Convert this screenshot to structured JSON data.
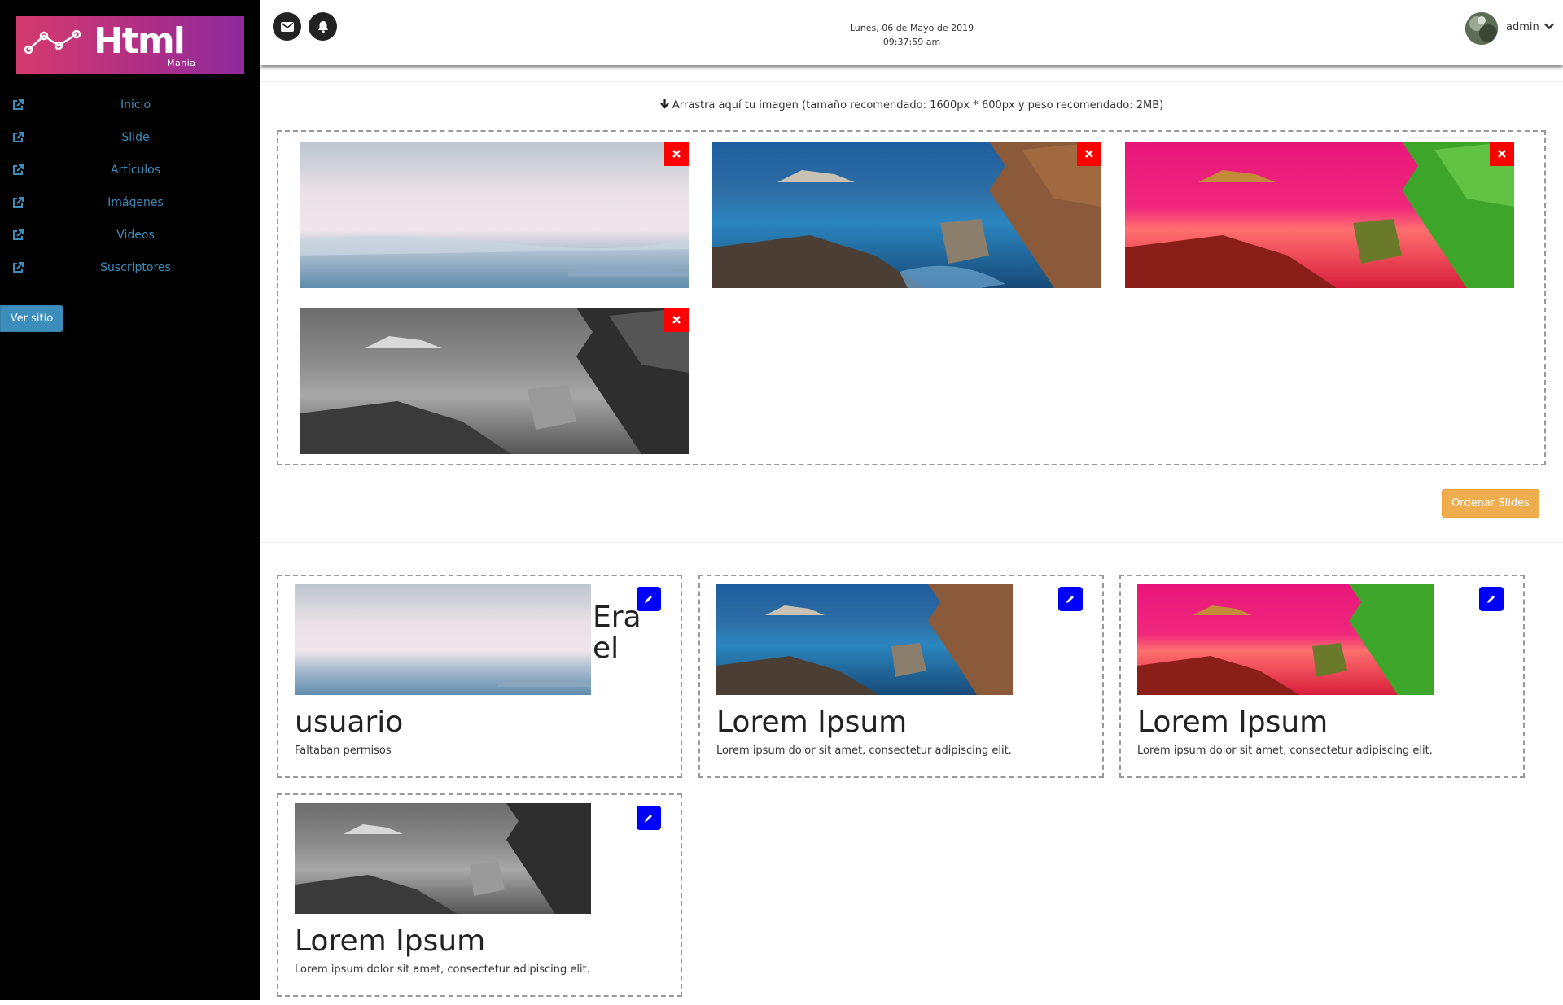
{
  "brand": {
    "title": "Html",
    "subtitle": "Mania"
  },
  "sidebar": {
    "items": [
      {
        "label": "Inicio",
        "icon": "external-link-icon"
      },
      {
        "label": "Slide",
        "icon": "external-link-icon"
      },
      {
        "label": "Artículos",
        "icon": "external-link-icon"
      },
      {
        "label": "Imágenes",
        "icon": "external-link-icon"
      },
      {
        "label": "Videos",
        "icon": "external-link-icon"
      },
      {
        "label": "Suscriptores",
        "icon": "external-link-icon"
      }
    ],
    "ver_sitio": "Ver sitio"
  },
  "header": {
    "date": "Lunes, 06 de Mayo de 2019",
    "time": "09:37:59 am",
    "user": "admin",
    "icons": [
      "envelope-icon",
      "bell-icon",
      "chevron-down-icon"
    ]
  },
  "upload": {
    "hint": "Arrastra aquí tu imagen (tamaño recomendado: 1600px * 600px y peso recomendado: 2MB)",
    "order_button": "Ordenar Slides"
  },
  "slides": [
    {
      "style": "sky"
    },
    {
      "style": "blue"
    },
    {
      "style": "pink"
    },
    {
      "style": "gray"
    }
  ],
  "cards": [
    {
      "title": "usuario",
      "title_wrap": "Era el",
      "text": "Faltaban permisos",
      "style": "sky"
    },
    {
      "title": "Lorem Ipsum",
      "text": "Lorem ipsum dolor sit amet, consectetur adipiscing elit.",
      "style": "blue"
    },
    {
      "title": "Lorem Ipsum",
      "text": "Lorem ipsum dolor sit amet, consectetur adipiscing elit.",
      "style": "pink"
    },
    {
      "title": "Lorem Ipsum",
      "text": "Lorem ipsum dolor sit amet, consectetur adipiscing elit.",
      "style": "gray"
    }
  ],
  "colors": {
    "sidebar_bg": "#000000",
    "link": "#3c8dbc",
    "delete": "#ff0000",
    "edit": "#0000ff",
    "order": "#f0ad4e"
  }
}
